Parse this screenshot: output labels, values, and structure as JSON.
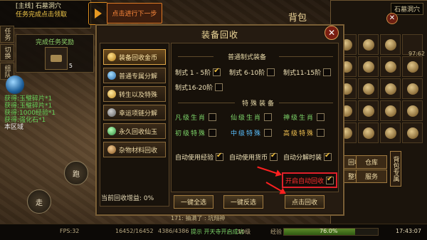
{
  "quest": {
    "line1": "[主线] 石墓洞穴",
    "line2": "任务完成点击领取",
    "next_button": "点击进行下一步"
  },
  "side_tabs": [
    "任务",
    "切换",
    "组队"
  ],
  "reward": {
    "title": "完成任务奖励",
    "count": "5"
  },
  "chat": {
    "lines": [
      "获得:玉璧碎片*1",
      "获得:玉璧碎片*1",
      "获得:1000经验*1",
      "获得:强化石*1"
    ],
    "warn": "本区域"
  },
  "bottom_left_buttons": [
    "跑",
    "走"
  ],
  "bag": {
    "title": "背包",
    "map_name": "石墓洞穴",
    "time_small": "97:62",
    "buttons": [
      "回收",
      "仓库",
      "整理",
      "服务"
    ],
    "side_label": "背包专属"
  },
  "dialog": {
    "title": "装备回收",
    "close": "✕",
    "categories": [
      "装备回收金币",
      "普通专属分解",
      "转生以及特殊",
      "幸运项链分解",
      "永久回收仙玉",
      "杂物材料回收"
    ],
    "gain_label": "当前回收增益: 0%",
    "sections": {
      "normal": {
        "title": "普通制式装备",
        "options": [
          {
            "label": "制式 1 - 5阶",
            "checked": true
          },
          {
            "label": "制式 6-10阶",
            "checked": false
          },
          {
            "label": "制式11-15阶",
            "checked": false
          },
          {
            "label": "制式16-20阶",
            "checked": false
          }
        ]
      },
      "special": {
        "title": "特殊装备",
        "options": [
          {
            "label": "凡级生肖",
            "checked": false
          },
          {
            "label": "仙级生肖",
            "checked": false
          },
          {
            "label": "神级生肖",
            "checked": false
          },
          {
            "label": "初级特殊",
            "checked": false
          },
          {
            "label": "中级特殊",
            "checked": false
          },
          {
            "label": "高级特殊",
            "checked": false
          }
        ]
      }
    },
    "auto": [
      {
        "label": "自动使用经验",
        "checked": true
      },
      {
        "label": "自动使用货币",
        "checked": true
      },
      {
        "label": "自动分解时装",
        "checked": true
      }
    ],
    "auto_recycle": {
      "label": "开启自动回收",
      "checked": true
    },
    "buttons": [
      "一键全选",
      "一键反选",
      "点击回收"
    ]
  },
  "hud": {
    "fps": "FPS:32",
    "hp": "16452/16452",
    "mp": "4386/4386",
    "level": "50级",
    "exp_label": "经验",
    "exp_percent": 76.0,
    "exp_text": "76.0%",
    "clock": "17:43:07",
    "msg1": "171: 抽满了 : 坑翔神",
    "msg2": "提示 开天寺开启成功"
  },
  "colors": {
    "accent": "#e0a848",
    "highlight_red": "#e0202a",
    "green_text": "#66d25a"
  }
}
